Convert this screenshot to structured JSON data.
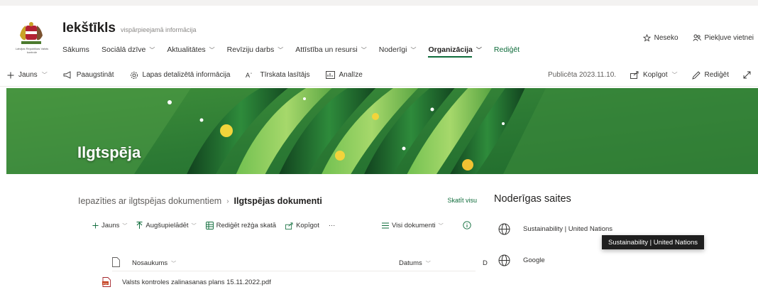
{
  "site": {
    "logo_caption": "Latvijas Republikas Valsts kontrole",
    "title": "Iekštīkls",
    "subtitle": "vispārpieejamā informācija",
    "nav": [
      {
        "label": "Sākums",
        "dropdown": false
      },
      {
        "label": "Sociālā dzīve",
        "dropdown": true
      },
      {
        "label": "Aktualitātes",
        "dropdown": true
      },
      {
        "label": "Revīziju darbs",
        "dropdown": true
      },
      {
        "label": "Attīstība un resursi",
        "dropdown": true
      },
      {
        "label": "Noderīgi",
        "dropdown": true
      },
      {
        "label": "Organizācija",
        "dropdown": true,
        "active": true
      },
      {
        "label": "Rediģēt",
        "dropdown": false
      }
    ],
    "follow_label": "Neseko",
    "access_label": "Piekļuve vietnei"
  },
  "command_bar": {
    "new_label": "Jauns",
    "promote_label": "Paaugstināt",
    "page_details_label": "Lapas detalizētā informācija",
    "immersive_reader_label": "Tīrskata lasītājs",
    "analytics_label": "Analīze",
    "published_label": "Publicēta 2023.11.10.",
    "share_label": "Kopīgot",
    "edit_label": "Rediģēt"
  },
  "banner": {
    "title": "Ilgtspēja"
  },
  "doclib": {
    "breadcrumb_parent": "Iepazīties ar ilgtspējas dokumentiem",
    "breadcrumb_current": "Ilgtspējas dokumenti",
    "see_all_label": "Skatīt visu",
    "toolbar": {
      "new_label": "Jauns",
      "upload_label": "Augšupielādēt",
      "grid_edit_label": "Rediģēt režģa skatā",
      "share_label": "Kopīgot",
      "more_label": "···",
      "view_label": "Visi dokumenti"
    },
    "columns": {
      "name": "Nosaukums",
      "date": "Datums",
      "truncated": "D"
    },
    "rows": [
      {
        "name": "Valsts kontroles zalinasanas plans 15.11.2022.pdf",
        "type": "pdf"
      }
    ]
  },
  "quick_links": {
    "title": "Noderīgas saites",
    "items": [
      {
        "label": "Sustainability | United Nations",
        "icon": "globe-icon"
      },
      {
        "label": "Google",
        "icon": "globe-icon"
      }
    ],
    "tooltip": "Sustainability | United Nations"
  },
  "colors": {
    "accent": "#0f6c3b",
    "banner_green": "#2f7d32"
  }
}
